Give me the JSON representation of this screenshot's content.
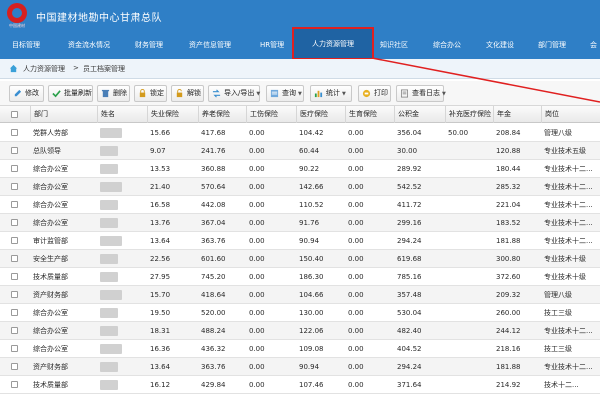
{
  "app": {
    "title": "中国建材地勘中心甘肃总队",
    "logo_caption": "中国建材"
  },
  "nav": {
    "items": [
      "目标管理",
      "资金流水情况",
      "财务管理",
      "资产信息管理",
      "HR管理",
      "人力资源管理",
      "知识社区",
      "综合办公",
      "文化建设",
      "部门管理",
      "会"
    ],
    "active_index": 5
  },
  "breadcrumb": {
    "items": [
      "人力资源管理",
      ">",
      "员工档案管理"
    ]
  },
  "toolbar": {
    "buttons": [
      {
        "label": "修改",
        "icon": "edit-icon"
      },
      {
        "label": "批量刷新",
        "icon": "check-icon"
      },
      {
        "label": "删除",
        "icon": "delete-icon"
      },
      {
        "label": "锁定",
        "icon": "lock-icon"
      },
      {
        "label": "解锁",
        "icon": "unlock-icon"
      },
      {
        "label": "导入/导出",
        "icon": "import-export-icon"
      },
      {
        "label": "查询",
        "icon": "search-icon"
      },
      {
        "label": "统计",
        "icon": "stats-icon"
      },
      {
        "label": "打印",
        "icon": "print-icon"
      },
      {
        "label": "查看日志",
        "icon": "log-icon"
      }
    ]
  },
  "table": {
    "columns": [
      "部门",
      "姓名",
      "失业保险",
      "养老保险",
      "工伤保险",
      "医疗保险",
      "生育保险",
      "公积金",
      "补充医疗保险",
      "年金",
      "岗位"
    ],
    "rows": [
      [
        "党群人劳部",
        "",
        "15.66",
        "417.68",
        "0.00",
        "104.42",
        "0.00",
        "356.04",
        "50.00",
        "208.84",
        "管理八级"
      ],
      [
        "总队领导",
        "",
        "9.07",
        "241.76",
        "0.00",
        "60.44",
        "0.00",
        "30.00",
        "",
        "120.88",
        "专业技术五级"
      ],
      [
        "综合办公室",
        "",
        "13.53",
        "360.88",
        "0.00",
        "90.22",
        "0.00",
        "289.92",
        "",
        "180.44",
        "专业技术十二..."
      ],
      [
        "综合办公室",
        "",
        "21.40",
        "570.64",
        "0.00",
        "142.66",
        "0.00",
        "542.52",
        "",
        "285.32",
        "专业技术十二..."
      ],
      [
        "综合办公室",
        "",
        "16.58",
        "442.08",
        "0.00",
        "110.52",
        "0.00",
        "411.72",
        "",
        "221.04",
        "专业技术十二..."
      ],
      [
        "综合办公室",
        "",
        "13.76",
        "367.04",
        "0.00",
        "91.76",
        "0.00",
        "299.16",
        "",
        "183.52",
        "专业技术十二..."
      ],
      [
        "审计监管部",
        "",
        "13.64",
        "363.76",
        "0.00",
        "90.94",
        "0.00",
        "294.24",
        "",
        "181.88",
        "专业技术十二..."
      ],
      [
        "安全生产部",
        "",
        "22.56",
        "601.60",
        "0.00",
        "150.40",
        "0.00",
        "619.68",
        "",
        "300.80",
        "专业技术十级"
      ],
      [
        "技术质量部",
        "",
        "27.95",
        "745.20",
        "0.00",
        "186.30",
        "0.00",
        "785.16",
        "",
        "372.60",
        "专业技术十级"
      ],
      [
        "资产财务部",
        "",
        "15.70",
        "418.64",
        "0.00",
        "104.66",
        "0.00",
        "357.48",
        "",
        "209.32",
        "管理八级"
      ],
      [
        "综合办公室",
        "",
        "19.50",
        "520.00",
        "0.00",
        "130.00",
        "0.00",
        "530.04",
        "",
        "260.00",
        "技工三级"
      ],
      [
        "综合办公室",
        "",
        "18.31",
        "488.24",
        "0.00",
        "122.06",
        "0.00",
        "482.40",
        "",
        "244.12",
        "专业技术十二..."
      ],
      [
        "综合办公室",
        "",
        "16.36",
        "436.32",
        "0.00",
        "109.08",
        "0.00",
        "404.52",
        "",
        "218.16",
        "技工三级"
      ],
      [
        "资产财务部",
        "",
        "13.64",
        "363.76",
        "0.00",
        "90.94",
        "0.00",
        "294.24",
        "",
        "181.88",
        "专业技术十二..."
      ],
      [
        "技术质量部",
        "",
        "16.12",
        "429.84",
        "0.00",
        "107.46",
        "0.00",
        "371.64",
        "",
        "214.92",
        "技术十二..."
      ]
    ]
  }
}
